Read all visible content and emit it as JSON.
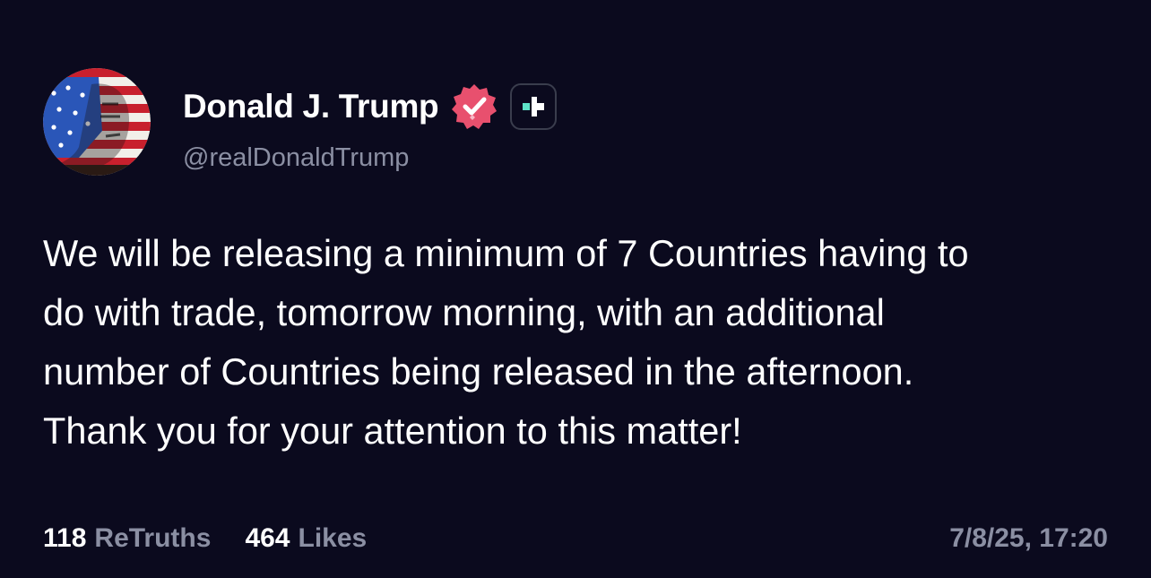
{
  "author": {
    "display_name": "Donald J. Trump",
    "handle": "@realDonaldTrump",
    "verified": true,
    "verified_badge_color": "#e8506e",
    "plus_badge_color": "#5ee3c8"
  },
  "post": {
    "lines": [
      "We will be releasing a minimum of 7 Countries having to",
      "do with trade, tomorrow morning, with an additional",
      "number of Countries being released in the afternoon.",
      "Thank you for your attention to this matter!"
    ]
  },
  "stats": {
    "retruths_count": "118",
    "retruths_label": "ReTruths",
    "likes_count": "464",
    "likes_label": "Likes"
  },
  "timestamp": "7/8/25, 17:20",
  "colors": {
    "background": "#0b0a1e",
    "text": "#ffffff",
    "muted": "#8b8fa3"
  }
}
